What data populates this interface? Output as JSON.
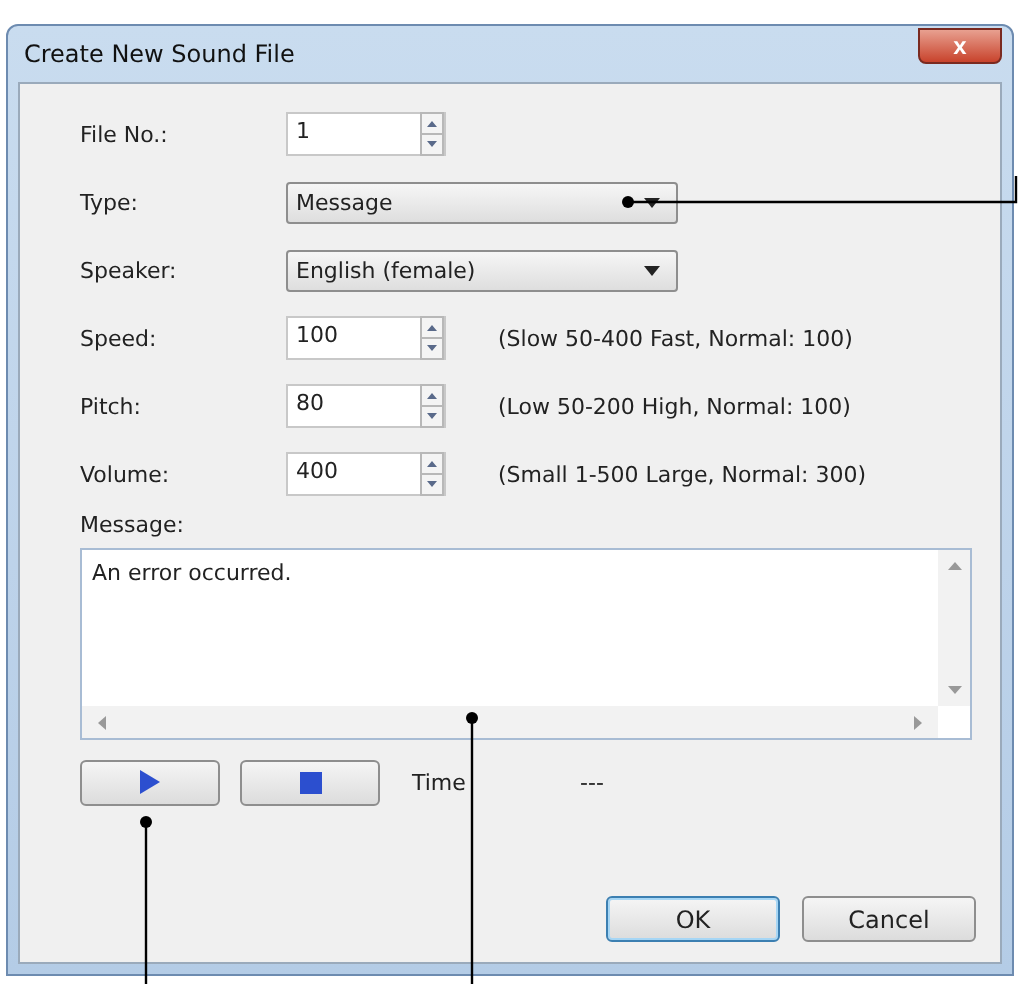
{
  "window": {
    "title": "Create New Sound File",
    "close": "x"
  },
  "fields": [
    {
      "kind": "spin",
      "label": "File No.:",
      "value": "1"
    },
    {
      "kind": "dropdown",
      "label": "Type:",
      "value": "Message"
    },
    {
      "kind": "dropdown",
      "label": "Speaker:",
      "value": "English (female)"
    },
    {
      "kind": "spin",
      "label": "Speed:",
      "value": "100",
      "hint": "(Slow 50-400 Fast, Normal: 100)"
    },
    {
      "kind": "spin",
      "label": "Pitch:",
      "value": "80",
      "hint": "(Low 50-200 High, Normal: 100)"
    },
    {
      "kind": "spin",
      "label": "Volume:",
      "value": "400",
      "hint": "(Small 1-500 Large, Normal: 300)"
    }
  ],
  "message": {
    "label": "Message:",
    "value": "An error occurred."
  },
  "playback": {
    "time_label": "Time",
    "time_value": "---"
  },
  "buttons": [
    {
      "label": "OK",
      "default": true
    },
    {
      "label": "Cancel",
      "default": false
    }
  ]
}
